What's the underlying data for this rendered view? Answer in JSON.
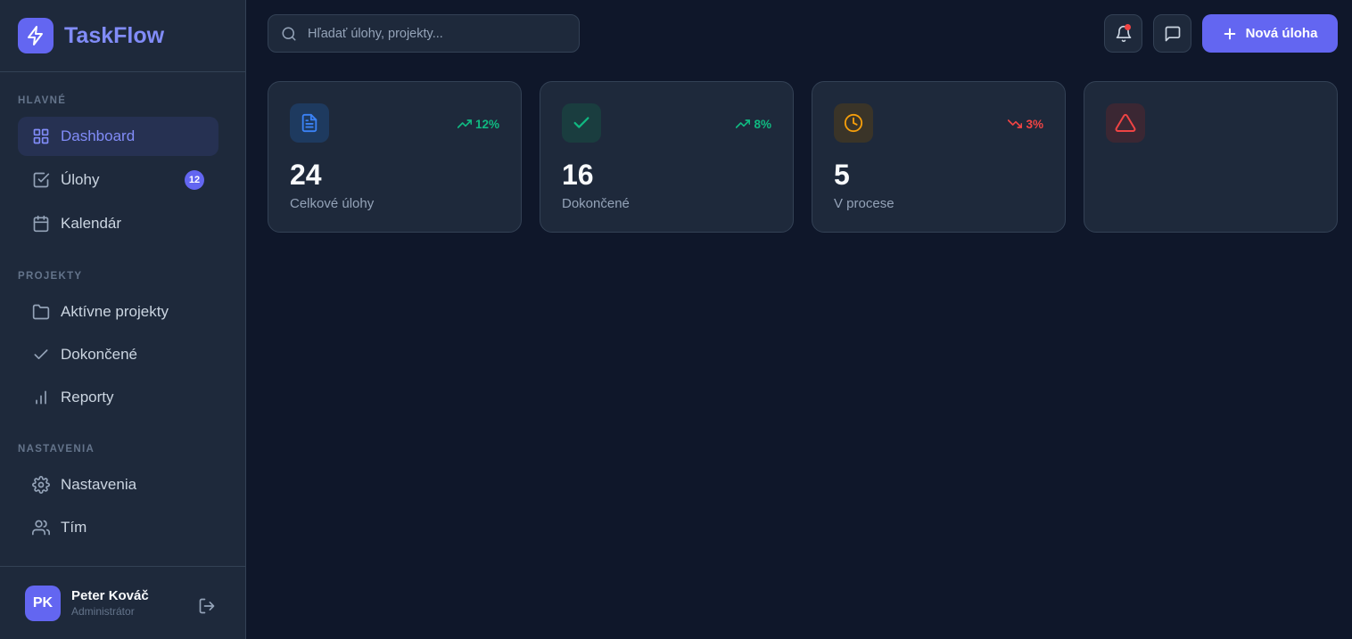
{
  "brand": {
    "name": "TaskFlow",
    "accent": "#6366f1"
  },
  "sidebar": {
    "sections": [
      {
        "title": "HLAVNÉ",
        "items": [
          {
            "label": "Dashboard",
            "icon": "grid-icon",
            "active": true
          },
          {
            "label": "Úlohy",
            "icon": "checkbox-icon",
            "badge": "12"
          },
          {
            "label": "Kalendár",
            "icon": "calendar-icon"
          }
        ]
      },
      {
        "title": "PROJEKTY",
        "items": [
          {
            "label": "Aktívne projekty",
            "icon": "folder-icon"
          },
          {
            "label": "Dokončené",
            "icon": "check-icon"
          },
          {
            "label": "Reporty",
            "icon": "bar-chart-icon"
          }
        ]
      },
      {
        "title": "NASTAVENIA",
        "items": [
          {
            "label": "Nastavenia",
            "icon": "gear-icon"
          },
          {
            "label": "Tím",
            "icon": "users-icon"
          }
        ]
      }
    ]
  },
  "user": {
    "initials": "PK",
    "name": "Peter Kováč",
    "role": "Administrátor"
  },
  "header": {
    "search_placeholder": "Hľadať úlohy, projekty...",
    "new_task_label": "Nová úloha"
  },
  "stats": [
    {
      "value": "24",
      "label": "Celkové úlohy",
      "trend": "12%",
      "trend_dir": "up",
      "icon": "document-icon",
      "icon_color": "#3b82f6",
      "icon_bg": "#1e3a5f"
    },
    {
      "value": "16",
      "label": "Dokončené",
      "trend": "8%",
      "trend_dir": "up",
      "icon": "check-icon",
      "icon_color": "#10b981",
      "icon_bg": "#1a3d3f"
    },
    {
      "value": "5",
      "label": "V procese",
      "trend": "3%",
      "trend_dir": "down",
      "icon": "clock-icon",
      "icon_color": "#f59e0b",
      "icon_bg": "#3a3428"
    },
    {
      "value": "",
      "label": "",
      "trend": "",
      "trend_dir": "",
      "icon": "warning-icon",
      "icon_color": "#ef4444",
      "icon_bg": "#3b2733"
    }
  ],
  "colors": {
    "up": "#10b981",
    "down": "#ef4444"
  }
}
